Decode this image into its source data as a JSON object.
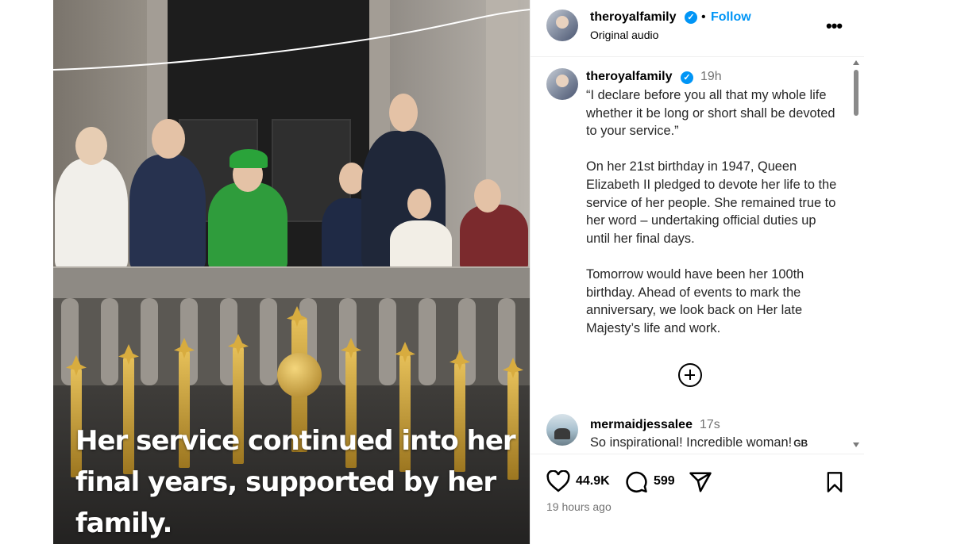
{
  "media": {
    "caption": "Her service continued into her final years, supported by her family."
  },
  "header": {
    "username": "theroyalfamily",
    "separator": "•",
    "follow_label": "Follow",
    "audio_label": "Original audio",
    "more_label": "•••",
    "verified_mark": "✓"
  },
  "post": {
    "username": "theroyalfamily",
    "time": "19h",
    "caption": "“I declare before you all that my whole life whether it be long or short shall be devoted to your service.”\n\nOn her 21st birthday in 1947, Queen Elizabeth II pledged to devote her life to the service of her people. She remained true to her word – undertaking official duties up until her final days.\n\nTomorrow would have been her 100th birthday. Ahead of events to mark the anniversary, we look back on Her late Majesty’s life and work."
  },
  "comments": [
    {
      "username": "mermaidjessalee",
      "time": "17s",
      "text": "So inspirational! Incredible woman!",
      "badge": "GB"
    }
  ],
  "actions": {
    "likes": "44.9K",
    "comments": "599",
    "posted_ago": "19 hours ago"
  },
  "colors": {
    "accent": "#0095f6",
    "muted": "#737373",
    "verified": "#0095f6"
  }
}
